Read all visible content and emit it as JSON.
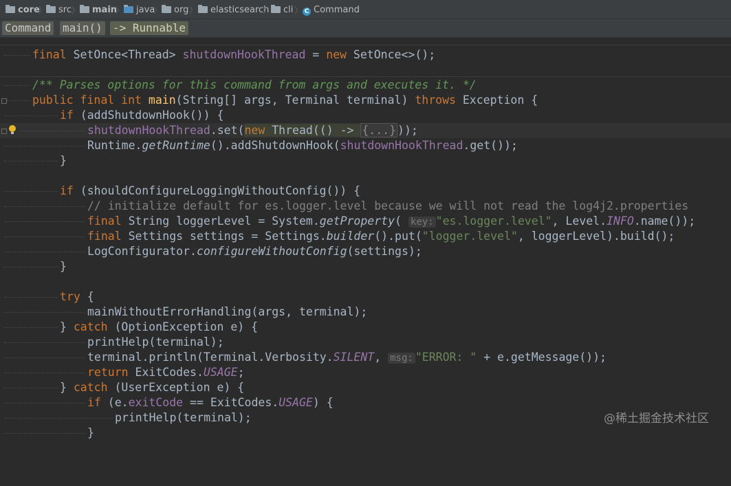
{
  "breadcrumb": {
    "items": [
      "core",
      "src",
      "main",
      "java",
      "org",
      "elasticsearch",
      "cli",
      "Command"
    ]
  },
  "navbar": {
    "chips": [
      "Command",
      "main()",
      "-> Runnable"
    ]
  },
  "code": {
    "field_decl": {
      "kw_final": "final",
      "type": " SetOnce<Thread> ",
      "field": "shutdownHookThread",
      "eq": " = ",
      "kw_new": "new",
      "rest": " SetOnce<>();"
    },
    "doc_comment": "/** Parses options for this command from args and executes it. */",
    "signature": {
      "kw": "public final int ",
      "name": "main",
      "p1": "(String[] args, Terminal terminal) ",
      "throws": "throws",
      "rest": " Exception {"
    },
    "if1": {
      "kw": "if",
      "rest": " (addShutdownHook()) {"
    },
    "set_line": {
      "field": "shutdownHookThread",
      "dot_set": ".set(",
      "kw_new": "new",
      "thread": " Thread(() -> ",
      "fold": "{...}",
      "end": "));"
    },
    "runtime_line": {
      "a": "Runtime.",
      "m": "getRuntime",
      "b": "().addShutdownHook(",
      "field": "shutdownHookThread",
      "c": ".get());"
    },
    "close1": "}",
    "if2": {
      "kw": "if",
      "rest": " (shouldConfigureLoggingWithoutConfig()) {"
    },
    "comment_line": "// initialize default for es.logger.level because we will not read the log4j2.properties",
    "logger_line": {
      "kw": "final",
      "a": " String loggerLevel = System.",
      "m": "getProperty",
      "b": "( ",
      "hint": "key:",
      "str": "\"es.logger.level\"",
      "c": ", Level.",
      "f": "INFO",
      "d": ".name());"
    },
    "settings_line": {
      "kw": "final",
      "a": " Settings settings = Settings.",
      "m": "builder",
      "b": "().put(",
      "str": "\"logger.level\"",
      "c": ", loggerLevel).build();"
    },
    "logconf_line": {
      "a": "LogConfigurator.",
      "m": "configureWithoutConfig",
      "b": "(settings);"
    },
    "close2": "}",
    "try_line": {
      "kw": "try",
      "rest": " {"
    },
    "main_call": "mainWithoutErrorHandling(args, terminal);",
    "catch1": {
      "a": "} ",
      "kw": "catch",
      "b": " (OptionException e) {"
    },
    "printhelp1": "printHelp(terminal);",
    "println_line": {
      "a": "terminal.println(Terminal.Verbosity.",
      "f": "SILENT",
      "b": ", ",
      "hint": "msg:",
      "str": "\"ERROR: \"",
      "c": " + e.getMessage());"
    },
    "return_line": {
      "kw": "return",
      "a": " ExitCodes.",
      "f": "USAGE",
      "b": ";"
    },
    "catch2": {
      "a": "} ",
      "kw": "catch",
      "b": " (UserException e) {"
    },
    "if3": {
      "kw": "if",
      "a": " (e.",
      "f": "exitCode",
      "b": " == ExitCodes.",
      "f2": "USAGE",
      "c": ") {"
    },
    "printhelp2": "printHelp(terminal);",
    "close3": "}"
  },
  "watermark": "@稀土掘金技术社区",
  "colors": {
    "background": "#2b2b2b",
    "keyword": "#cc7832",
    "field": "#9876aa",
    "method": "#ffc66d",
    "string": "#6a8759",
    "doc": "#629755",
    "comment": "#808080"
  }
}
